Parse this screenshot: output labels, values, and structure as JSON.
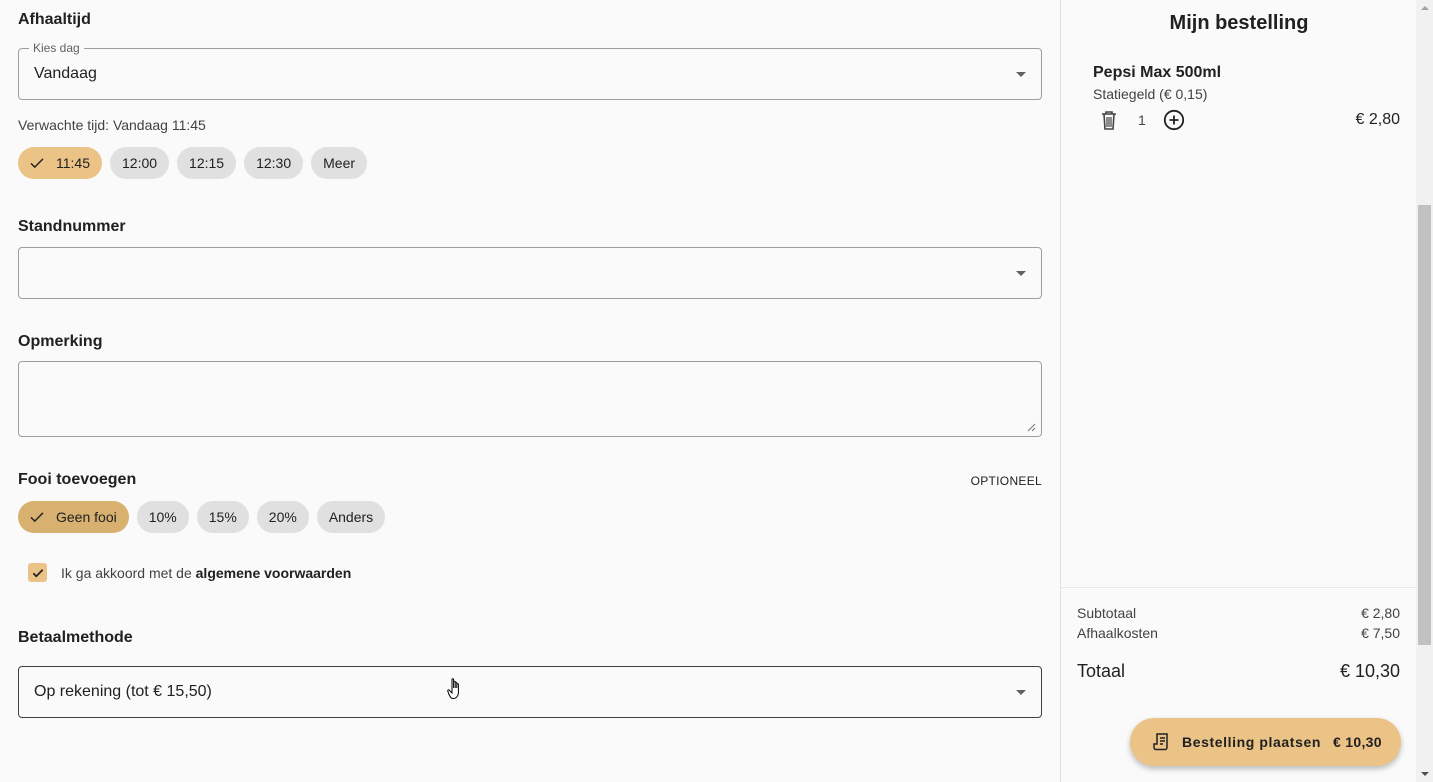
{
  "pickup": {
    "title": "Afhaaltijd",
    "day_label": "Kies dag",
    "day_value": "Vandaag",
    "expected_time": "Verwachte tijd: Vandaag 11:45",
    "time_chips": [
      "11:45",
      "12:00",
      "12:15",
      "12:30",
      "Meer"
    ],
    "selected_time": "11:45"
  },
  "stand": {
    "title": "Standnummer",
    "value": ""
  },
  "remark": {
    "title": "Opmerking",
    "value": ""
  },
  "tip": {
    "title": "Fooi toevoegen",
    "optional_label": "OPTIONEEL",
    "chips": [
      "Geen fooi",
      "10%",
      "15%",
      "20%",
      "Anders"
    ],
    "selected": "Geen fooi"
  },
  "terms": {
    "checked": true,
    "text": "Ik ga akkoord met de",
    "link_text": "algemene voorwaarden"
  },
  "payment": {
    "title": "Betaalmethode",
    "value": "Op rekening (tot € 15,50)"
  },
  "order": {
    "title": "Mijn bestelling",
    "items": [
      {
        "name": "Pepsi Max 500ml",
        "sub": "Statiegeld (€ 0,15)",
        "qty": "1",
        "price": "€ 2,80"
      }
    ],
    "subtotal_label": "Subtotaal",
    "subtotal": "€ 2,80",
    "pickup_cost_label": "Afhaalkosten",
    "pickup_cost": "€ 7,50",
    "total_label": "Totaal",
    "total": "€ 10,30",
    "place_order_label": "Bestelling plaatsen",
    "place_order_price": "€ 10,30"
  },
  "colors": {
    "accent": "#ecc386",
    "accent_dark": "#d8b06f",
    "chip_bg": "#e0e0e0"
  },
  "icons": [
    "check-icon",
    "dropdown-caret-icon",
    "trash-icon",
    "plus-circle-icon",
    "receipt-icon",
    "hand-cursor-icon"
  ]
}
